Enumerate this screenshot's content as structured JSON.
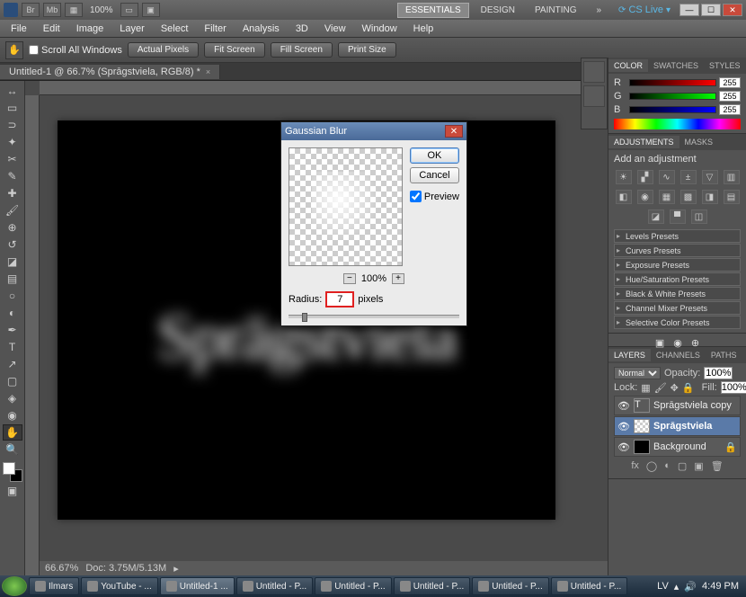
{
  "titlebar": {
    "zoom_pct": "100%",
    "workspaces": [
      "ESSENTIALS",
      "DESIGN",
      "PAINTING"
    ],
    "cslive": "CS Live"
  },
  "menubar": [
    "File",
    "Edit",
    "Image",
    "Layer",
    "Select",
    "Filter",
    "Analysis",
    "3D",
    "View",
    "Window",
    "Help"
  ],
  "options": {
    "scroll_all": "Scroll All Windows",
    "actual": "Actual Pixels",
    "fit": "Fit Screen",
    "fill": "Fill Screen",
    "print": "Print Size"
  },
  "doctab": {
    "title": "Untitled-1 @ 66.7% (Sprāgstviela, RGB/8) *"
  },
  "canvas": {
    "text": "Sprāgstviela"
  },
  "statusbar": {
    "zoom": "66.67%",
    "doc": "Doc: 3.75M/5.13M"
  },
  "color": {
    "r_label": "R",
    "g_label": "G",
    "b_label": "B",
    "r": "255",
    "g": "255",
    "b": "255",
    "tabs": [
      "COLOR",
      "SWATCHES",
      "STYLES"
    ]
  },
  "adjustments": {
    "tabs": [
      "ADJUSTMENTS",
      "MASKS"
    ],
    "title": "Add an adjustment",
    "presets": [
      "Levels Presets",
      "Curves Presets",
      "Exposure Presets",
      "Hue/Saturation Presets",
      "Black & White Presets",
      "Channel Mixer Presets",
      "Selective Color Presets"
    ]
  },
  "layers": {
    "tabs": [
      "LAYERS",
      "CHANNELS",
      "PATHS"
    ],
    "blend": "Normal",
    "opacity_lbl": "Opacity:",
    "opacity": "100%",
    "lock_lbl": "Lock:",
    "fill_lbl": "Fill:",
    "fill": "100%",
    "rows": [
      {
        "name": "Sprāgstviela copy",
        "type": "T"
      },
      {
        "name": "Sprāgstviela",
        "type": "chk",
        "sel": true
      },
      {
        "name": "Background",
        "type": "bk",
        "lock": true
      }
    ]
  },
  "dialog": {
    "title": "Gaussian Blur",
    "ok": "OK",
    "cancel": "Cancel",
    "preview_lbl": "Preview",
    "zoom": "100%",
    "radius_lbl": "Radius:",
    "radius": "7",
    "pixels": "pixels"
  },
  "taskbar": {
    "items": [
      "Ilmars",
      "YouTube - ...",
      "Untitled-1 ...",
      "Untitled - P...",
      "Untitled - P...",
      "Untitled - P...",
      "Untitled - P...",
      "Untitled - P..."
    ],
    "lang": "LV",
    "time": "4:49 PM"
  }
}
